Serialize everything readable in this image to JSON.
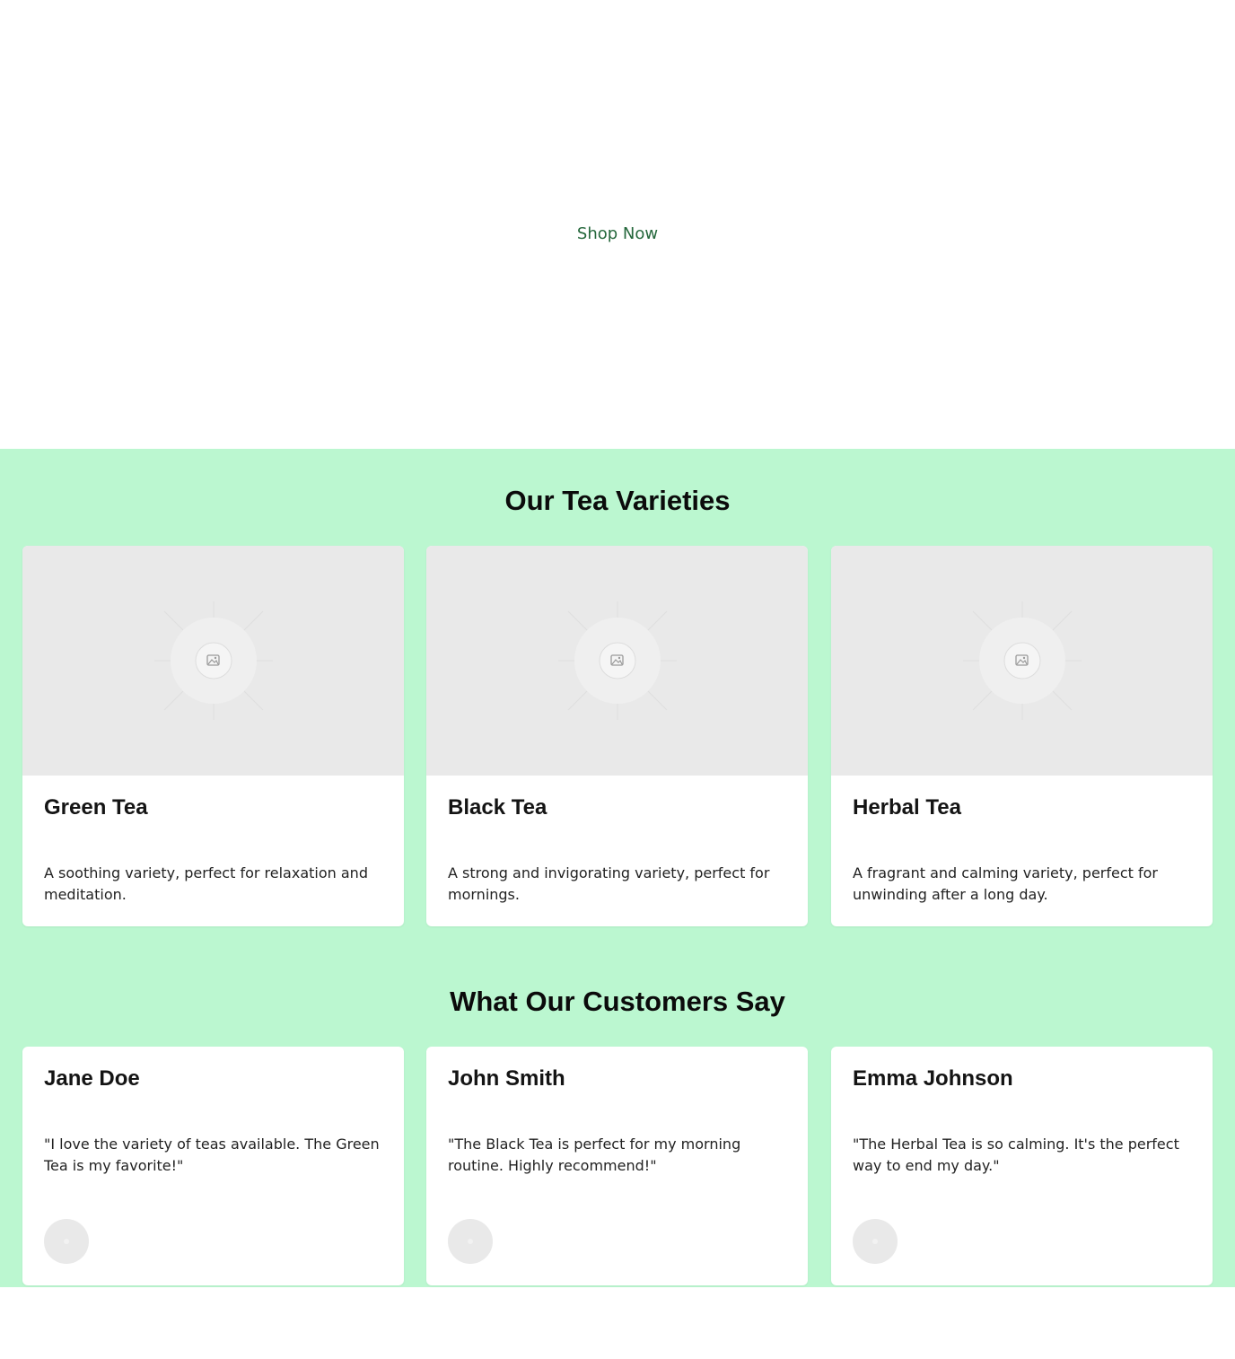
{
  "hero": {
    "cta_label": "Shop Now"
  },
  "varieties": {
    "title": "Our Tea Varieties",
    "items": [
      {
        "name": "Green Tea",
        "description": "A soothing variety, perfect for relaxation and meditation."
      },
      {
        "name": "Black Tea",
        "description": "A strong and invigorating variety, perfect for mornings."
      },
      {
        "name": "Herbal Tea",
        "description": "A fragrant and calming variety, perfect for unwinding after a long day."
      }
    ]
  },
  "testimonials": {
    "title": "What Our Customers Say",
    "items": [
      {
        "name": "Jane Doe",
        "quote": "\"I love the variety of teas available. The Green Tea is my favorite!\""
      },
      {
        "name": "John Smith",
        "quote": "\"The Black Tea is perfect for my morning routine. Highly recommend!\""
      },
      {
        "name": "Emma Johnson",
        "quote": "\"The Herbal Tea is so calming. It's the perfect way to end my day.\""
      }
    ]
  },
  "colors": {
    "section_bg": "#bbf7d0",
    "cta_text": "#24673b",
    "placeholder_bg": "#e9e9e9"
  },
  "icons": {
    "product_image": "image-placeholder-icon",
    "avatar": "avatar-placeholder"
  }
}
